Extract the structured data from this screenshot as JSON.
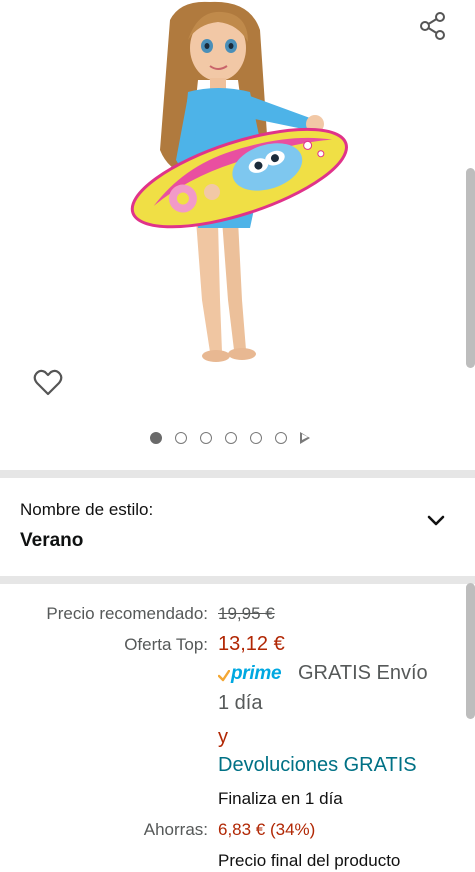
{
  "gallery": {
    "image_alt": "Muñeca con tabla de surf",
    "share_icon": "share-icon",
    "wishlist_icon": "heart-icon",
    "dots_total": 6,
    "active_dot": 1,
    "next_icon": "play-icon"
  },
  "style": {
    "label": "Nombre de estilo:",
    "value": "Verano",
    "chevron_icon": "chevron-down-icon"
  },
  "pricing": {
    "list_price_label": "Precio recomendado:",
    "list_price": "19,95 €",
    "deal_label": "Oferta Top:",
    "deal_price": "13,12 €",
    "prime_label": "prime",
    "free_shipping": "GRATIS Envío",
    "delivery_time": "1 día",
    "and_word": "y",
    "free_returns": "Devoluciones GRATIS",
    "deal_ends": "Finaliza en 1 día",
    "savings_label": "Ahorras:",
    "savings_value": "6,83 € (34%)",
    "final_price_note": "Precio final del producto"
  },
  "colors": {
    "price_red": "#b12704",
    "link_teal": "#007185",
    "prime_blue": "#00a8e1",
    "prime_check": "#f4a733",
    "divider": "#e6e6e6"
  }
}
